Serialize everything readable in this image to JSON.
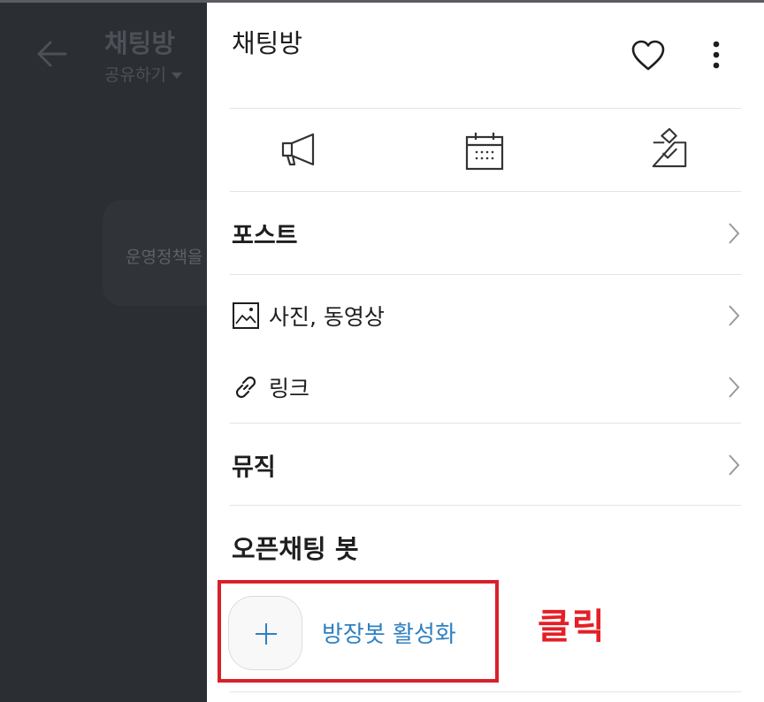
{
  "background": {
    "title": "채팅방",
    "share_label": "공유하기",
    "notice_text": "운영정책을"
  },
  "drawer": {
    "title": "채팅방",
    "header_icons": [
      "heart-icon",
      "more-vertical-icon"
    ],
    "quick_actions": [
      "megaphone-icon",
      "calendar-icon",
      "vote-box-icon"
    ],
    "menu": [
      {
        "label": "포스트",
        "icon": null,
        "bold": true
      },
      {
        "label": "사진, 동영상",
        "icon": "image-icon",
        "bold": false
      },
      {
        "label": "링크",
        "icon": "link-icon",
        "bold": false
      },
      {
        "label": "뮤직",
        "icon": null,
        "bold": true
      }
    ],
    "bot_section": {
      "title": "오픈채팅 봇",
      "action_label": "방장봇 활성화",
      "action_icon": "plus-icon"
    }
  },
  "annotation": {
    "text": "클릭",
    "color": "#e41f26",
    "box_color": "#d8202b"
  },
  "colors": {
    "background_overlay": "#2b2e33",
    "accent_blue": "#2f80c1",
    "divider": "#e3e3e3"
  }
}
